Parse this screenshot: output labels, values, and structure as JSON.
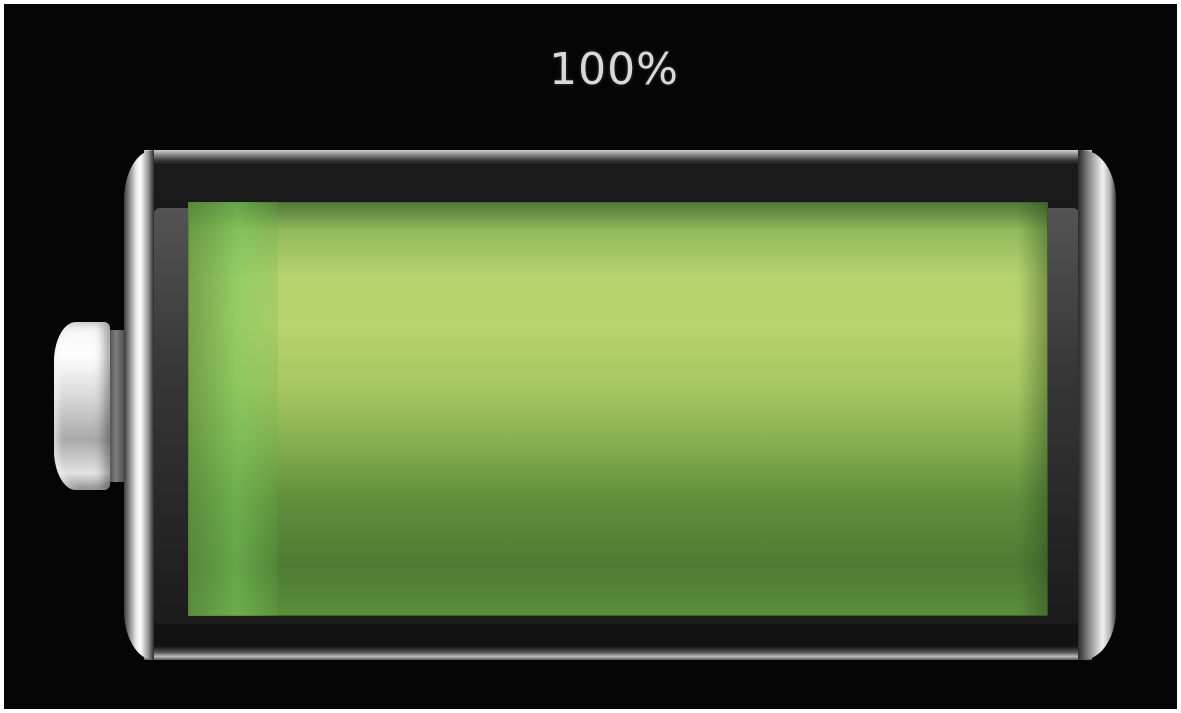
{
  "battery": {
    "percent_label": "100%",
    "charge_level": 1.0,
    "fill_color": "#a6c762"
  },
  "icons": {
    "battery": "battery-full-icon"
  }
}
